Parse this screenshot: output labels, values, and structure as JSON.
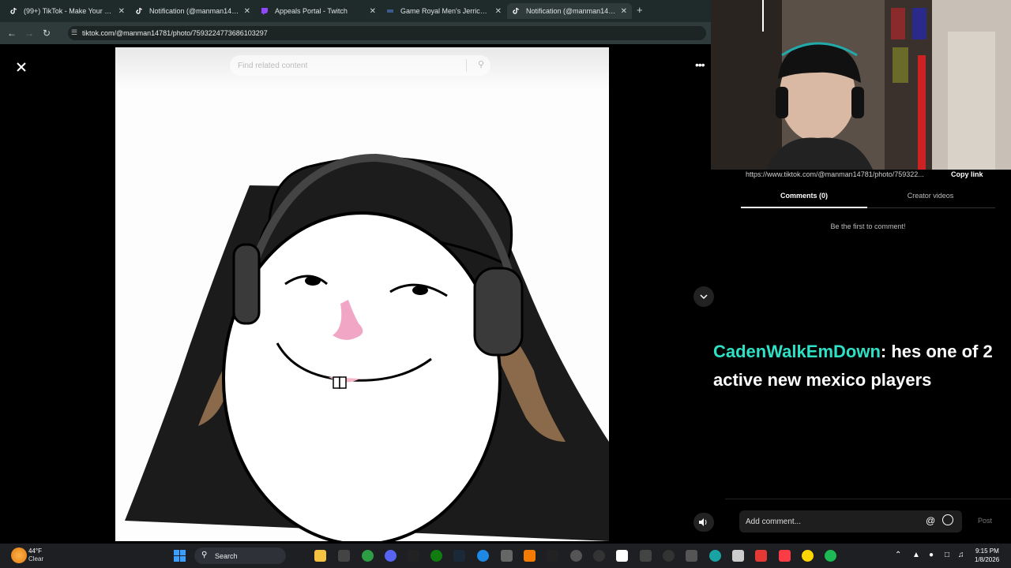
{
  "browser": {
    "tabs": [
      {
        "title": "(99+) TikTok - Make Your Day",
        "icon": "tiktok-icon",
        "active": false
      },
      {
        "title": "Notification (@manman14781)",
        "icon": "tiktok-icon",
        "active": false
      },
      {
        "title": "Appeals Portal - Twitch",
        "icon": "twitch-icon",
        "active": false
      },
      {
        "title": "Game Royal Men's Jerrick Reed",
        "icon": "site-icon",
        "active": false
      },
      {
        "title": "Notification (@manman14781)",
        "icon": "tiktok-icon",
        "active": true
      }
    ],
    "new_tab": "+",
    "close_glyph": "✕",
    "url": "tiktok.com/@manman14781/photo/7593224773686103297"
  },
  "viewer": {
    "search_placeholder": "Find related content",
    "more_glyph": "•••"
  },
  "panel": {
    "share_link": "https://www.tiktok.com/@manman14781/photo/759322...",
    "copy_link_label": "Copy link",
    "tabs": [
      "Comments (0)",
      "Creator videos"
    ],
    "empty_state": "Be the first to comment!",
    "comment_placeholder": "Add comment...",
    "at_glyph": "@",
    "post_label": "Post"
  },
  "chat_overlay": {
    "username": "CadenWalkEmDown",
    "separator": ":",
    "message": " hes one of 2 active new mexico players"
  },
  "taskbar": {
    "weather_temp": "44°F",
    "weather_condition": "Clear",
    "search_label": "Search",
    "time": "9:15 PM",
    "date": "1/8/2026"
  },
  "colors": {
    "chat_username": "#2ee0c4",
    "browser_bg": "#2f3a3a",
    "taskbar_bg": "#1d1f23"
  }
}
